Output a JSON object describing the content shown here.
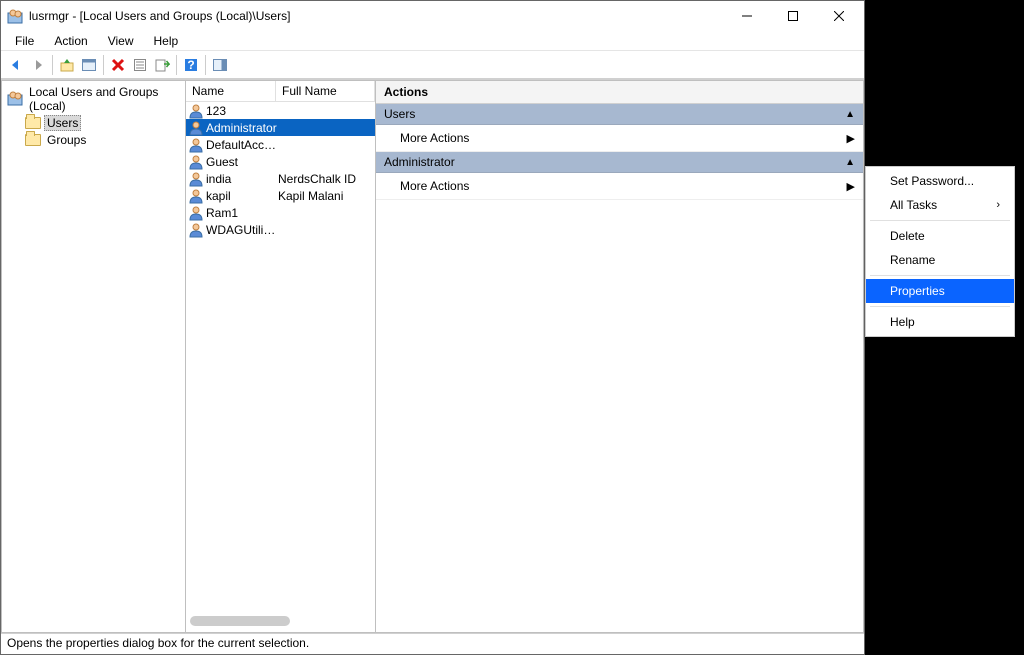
{
  "window": {
    "title": "lusrmgr - [Local Users and Groups (Local)\\Users]"
  },
  "menu": {
    "file": "File",
    "action": "Action",
    "view": "View",
    "help": "Help"
  },
  "tree": {
    "root": "Local Users and Groups (Local)",
    "users": "Users",
    "groups": "Groups"
  },
  "list": {
    "headers": {
      "name": "Name",
      "full": "Full Name"
    },
    "rows": [
      {
        "name": "123",
        "full": ""
      },
      {
        "name": "Administrator",
        "full": "",
        "selected": true
      },
      {
        "name": "DefaultAcco...",
        "full": ""
      },
      {
        "name": "Guest",
        "full": ""
      },
      {
        "name": "india",
        "full": "NerdsChalk ID"
      },
      {
        "name": "kapil",
        "full": "Kapil Malani"
      },
      {
        "name": "Ram1",
        "full": ""
      },
      {
        "name": "WDAGUtility...",
        "full": ""
      }
    ]
  },
  "actions": {
    "title": "Actions",
    "section1": "Users",
    "item1": "More Actions",
    "section2": "Administrator",
    "item2": "More Actions"
  },
  "context": {
    "set_password": "Set Password...",
    "all_tasks": "All Tasks",
    "delete": "Delete",
    "rename": "Rename",
    "properties": "Properties",
    "help": "Help"
  },
  "status": "Opens the properties dialog box for the current selection."
}
